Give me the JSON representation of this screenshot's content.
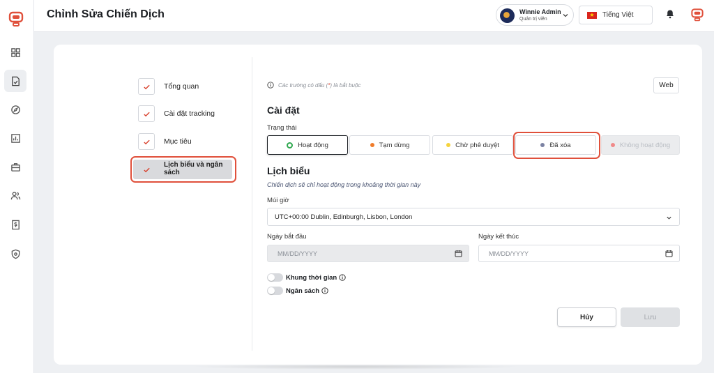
{
  "header": {
    "title": "Chỉnh Sửa Chiến Dịch",
    "user": {
      "name": "Winnie Admin",
      "role": "Quản trị viên"
    },
    "language": "Tiếng Việt"
  },
  "sidebar": {
    "items": [
      {
        "icon": "dashboard-icon"
      },
      {
        "icon": "document-icon",
        "active": true
      },
      {
        "icon": "compass-icon"
      },
      {
        "icon": "chart-icon"
      },
      {
        "icon": "briefcase-icon"
      },
      {
        "icon": "users-icon"
      },
      {
        "icon": "invoice-icon"
      },
      {
        "icon": "shield-icon"
      }
    ]
  },
  "steps": [
    {
      "label": "Tổng quan"
    },
    {
      "label": "Cài đặt tracking"
    },
    {
      "label": "Mục tiêu"
    },
    {
      "label": "Lịch biểu và ngân sách",
      "active": true
    }
  ],
  "form": {
    "note_prefix": "Các trường có dấu (",
    "note_star": "*",
    "note_suffix": ") là bắt buộc",
    "web_label": "Web",
    "settings_title": "Cài đặt",
    "status_label": "Trạng thái",
    "statuses": [
      {
        "label": "Hoạt động",
        "color": "#2fa84f",
        "selected": true
      },
      {
        "label": "Tạm dừng",
        "color": "#f07c2b"
      },
      {
        "label": "Chờ phê duyệt",
        "color": "#f5d33c"
      },
      {
        "label": "Đã xóa",
        "color": "#7b82a3"
      },
      {
        "label": "Không hoạt động",
        "color": "#f08a8a",
        "disabled": true
      }
    ],
    "schedule_title": "Lịch biểu",
    "schedule_subtitle": "Chiến dịch sẽ chỉ hoạt động trong khoảng thời gian này",
    "timezone_label": "Múi giờ",
    "timezone_value": "UTC+00:00 Dublin, Edinburgh, Lisbon, London",
    "start_label": "Ngày bắt đầu",
    "start_placeholder": "MM/DD/YYYY",
    "end_label": "Ngày kết thúc",
    "end_placeholder": "MM/DD/YYYY",
    "timeframe_label": "Khung thời gian",
    "budget_label": "Ngân sách",
    "cancel_label": "Hủy",
    "save_label": "Lưu"
  },
  "colors": {
    "accent_red": "#e0503b",
    "success": "#2fa84f"
  }
}
